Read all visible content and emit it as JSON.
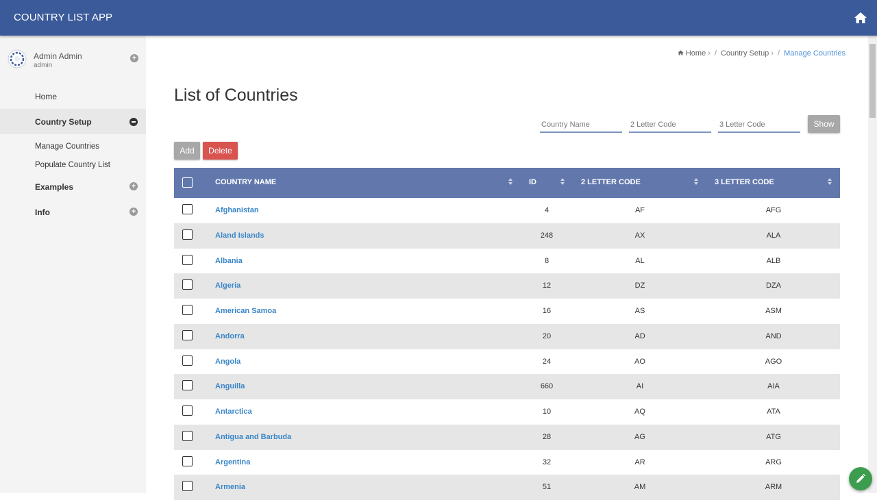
{
  "app": {
    "title": "COUNTRY LIST APP"
  },
  "user": {
    "name": "Admin Admin",
    "role": "admin"
  },
  "sidebar": {
    "items": [
      {
        "label": "Home"
      },
      {
        "label": "Country Setup"
      },
      {
        "label": "Manage Countries"
      },
      {
        "label": "Populate Country List"
      },
      {
        "label": "Examples"
      },
      {
        "label": "Info"
      }
    ]
  },
  "breadcrumb": {
    "home": "Home",
    "section": "Country Setup",
    "current": "Manage Countries"
  },
  "page": {
    "title": "List of Countries"
  },
  "filters": {
    "country_name_placeholder": "Country Name",
    "code2_placeholder": "2 Letter Code",
    "code3_placeholder": "3 Letter Code",
    "show_label": "Show"
  },
  "actions": {
    "add_label": "Add",
    "delete_label": "Delete"
  },
  "table": {
    "headers": {
      "name": "COUNTRY NAME",
      "id": "ID",
      "code2": "2 LETTER CODE",
      "code3": "3 LETTER CODE"
    },
    "rows": [
      {
        "name": "Afghanistan",
        "id": "4",
        "code2": "AF",
        "code3": "AFG"
      },
      {
        "name": "Aland Islands",
        "id": "248",
        "code2": "AX",
        "code3": "ALA"
      },
      {
        "name": "Albania",
        "id": "8",
        "code2": "AL",
        "code3": "ALB"
      },
      {
        "name": "Algeria",
        "id": "12",
        "code2": "DZ",
        "code3": "DZA"
      },
      {
        "name": "American Samoa",
        "id": "16",
        "code2": "AS",
        "code3": "ASM"
      },
      {
        "name": "Andorra",
        "id": "20",
        "code2": "AD",
        "code3": "AND"
      },
      {
        "name": "Angola",
        "id": "24",
        "code2": "AO",
        "code3": "AGO"
      },
      {
        "name": "Anguilla",
        "id": "660",
        "code2": "AI",
        "code3": "AIA"
      },
      {
        "name": "Antarctica",
        "id": "10",
        "code2": "AQ",
        "code3": "ATA"
      },
      {
        "name": "Antigua and Barbuda",
        "id": "28",
        "code2": "AG",
        "code3": "ATG"
      },
      {
        "name": "Argentina",
        "id": "32",
        "code2": "AR",
        "code3": "ARG"
      },
      {
        "name": "Armenia",
        "id": "51",
        "code2": "AM",
        "code3": "ARM"
      }
    ]
  },
  "colors": {
    "topbar": "#3a5a9a",
    "table_header": "#6278ad",
    "link": "#3a86c8",
    "danger": "#d9534f",
    "fab": "#3c9d4e"
  },
  "icons": {
    "home": "home-icon",
    "fab": "pencil-icon",
    "avatar": "user-avatar-icon"
  }
}
